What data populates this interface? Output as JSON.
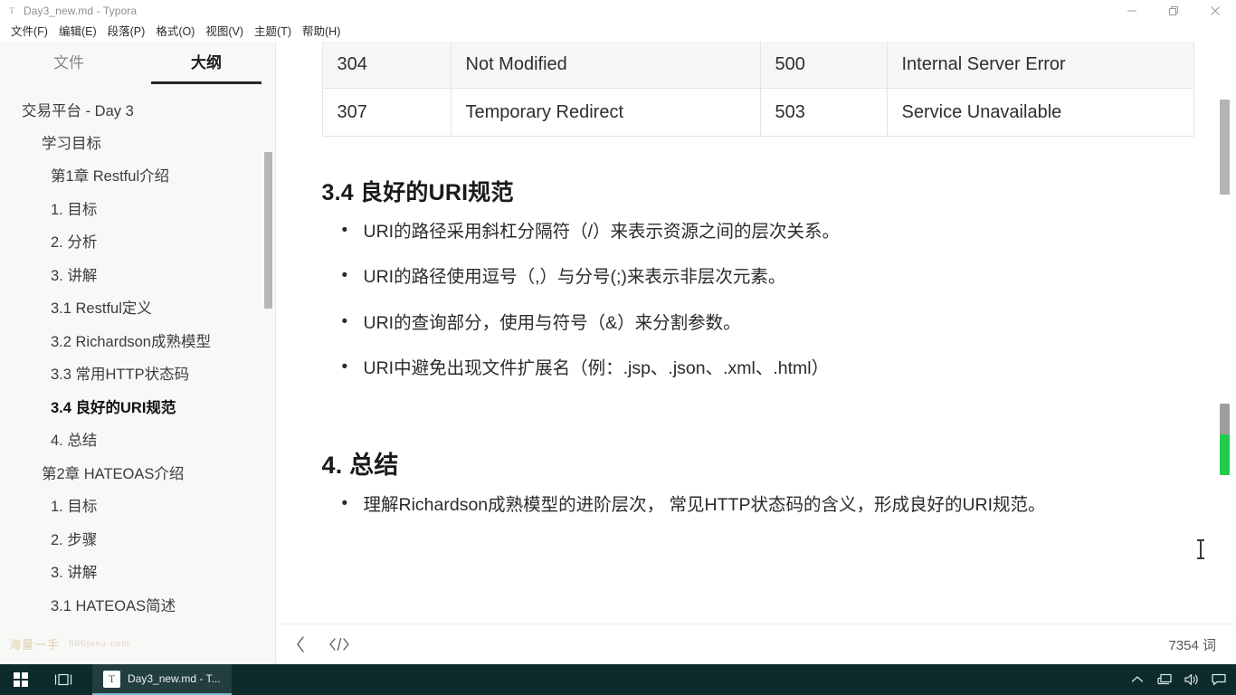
{
  "window": {
    "title": "Day3_new.md - Typora",
    "app_icon": "typora-icon",
    "minimize_label": "minimize-icon",
    "maximize_label": "restore-icon",
    "close_label": "close-icon"
  },
  "menubar": {
    "items": [
      {
        "label": "文件(F)",
        "name": "menu-file"
      },
      {
        "label": "编辑(E)",
        "name": "menu-edit"
      },
      {
        "label": "段落(P)",
        "name": "menu-paragraph"
      },
      {
        "label": "格式(O)",
        "name": "menu-format"
      },
      {
        "label": "视图(V)",
        "name": "menu-view"
      },
      {
        "label": "主题(T)",
        "name": "menu-theme"
      },
      {
        "label": "帮助(H)",
        "name": "menu-help"
      }
    ]
  },
  "sidebar": {
    "tabs": [
      {
        "label": "文件",
        "active": false
      },
      {
        "label": "大纲",
        "active": true
      }
    ],
    "outline": [
      {
        "label": "交易平台 - Day 3",
        "level": 1,
        "active": false
      },
      {
        "label": "学习目标",
        "level": 2,
        "active": false
      },
      {
        "label": "第1章 Restful介绍",
        "level": 3,
        "active": false
      },
      {
        "label": "1. 目标",
        "level": 3,
        "active": false
      },
      {
        "label": "2. 分析",
        "level": 3,
        "active": false
      },
      {
        "label": "3. 讲解",
        "level": 3,
        "active": false
      },
      {
        "label": "3.1 Restful定义",
        "level": 4,
        "active": false
      },
      {
        "label": "3.2 Richardson成熟模型",
        "level": 4,
        "active": false
      },
      {
        "label": "3.3 常用HTTP状态码",
        "level": 4,
        "active": false
      },
      {
        "label": "3.4 良好的URI规范",
        "level": 4,
        "active": true
      },
      {
        "label": "4. 总结",
        "level": 3,
        "active": false
      },
      {
        "label": "第2章 HATEOAS介绍",
        "level": 2,
        "active": false
      },
      {
        "label": "1. 目标",
        "level": 3,
        "active": false
      },
      {
        "label": "2. 步骤",
        "level": 3,
        "active": false
      },
      {
        "label": "3. 讲解",
        "level": 3,
        "active": false
      },
      {
        "label": "3.1 HATEOAS简述",
        "level": 4,
        "active": false
      }
    ],
    "watermark": {
      "cn": "海量一手",
      "site": "666java.com"
    }
  },
  "document": {
    "table": {
      "rows": [
        {
          "code1": "304",
          "text1": "Not Modified",
          "code2": "500",
          "text2": "Internal Server Error",
          "alt": true
        },
        {
          "code1": "307",
          "text1": "Temporary Redirect",
          "code2": "503",
          "text2": "Service Unavailable",
          "alt": false
        }
      ]
    },
    "section_uri": {
      "heading": "3.4 良好的URI规范",
      "bullets": [
        "URI的路径采用斜杠分隔符（/）来表示资源之间的层次关系。",
        "URI的路径使用逗号（,）与分号(;)来表示非层次元素。",
        "URI的查询部分，使用与符号（&）来分割参数。",
        "URI中避免出现文件扩展名（例：.jsp、.json、.xml、.html）"
      ]
    },
    "section_summary": {
      "heading": "4. 总结",
      "bullets": [
        "理解Richardson成熟模型的进阶层次， 常见HTTP状态码的含义，形成良好的URI规范。"
      ]
    }
  },
  "statusbar": {
    "back_icon": "back-chevron-icon",
    "source_icon": "source-code-icon",
    "word_count": "7354 词"
  },
  "taskbar": {
    "start_icon": "windows-start-icon",
    "taskview_icon": "task-view-icon",
    "app": {
      "icon_letter": "T",
      "label": "Day3_new.md - T..."
    },
    "tray": [
      {
        "name": "show-hidden-icons-chevron-icon"
      },
      {
        "name": "network-icon"
      },
      {
        "name": "volume-icon"
      },
      {
        "name": "action-center-icon"
      }
    ]
  },
  "colors": {
    "accent_green": "#22cc4a",
    "taskbar_bg": "#0d2b2b",
    "sidebar_bg": "#f8f8f7",
    "table_alt_row": "#f6f6f6"
  }
}
